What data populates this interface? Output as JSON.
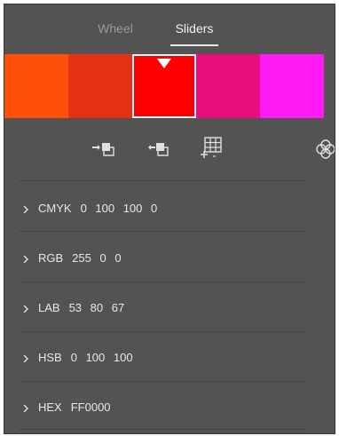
{
  "tabs": [
    {
      "label": "Wheel",
      "active": false
    },
    {
      "label": "Sliders",
      "active": true
    }
  ],
  "swatches": [
    {
      "color": "#FF4F0B"
    },
    {
      "color": "#E53212"
    },
    {
      "color": "#FF0000",
      "active": true
    },
    {
      "color": "#EA0E7D"
    },
    {
      "color": "#FF19F4"
    }
  ],
  "toolbar": {
    "icons": [
      "move-to-fill-icon",
      "move-to-stroke-icon",
      "add-to-swatches-grid-icon",
      "color-harmony-icon"
    ]
  },
  "modes": [
    {
      "label": "CMYK",
      "values": "0 100 100 0"
    },
    {
      "label": "RGB",
      "values": "255 0 0"
    },
    {
      "label": "LAB",
      "values": "53 80 67"
    },
    {
      "label": "HSB",
      "values": "0 100 100"
    },
    {
      "label": "HEX",
      "values": "FF0000"
    }
  ],
  "colors": {
    "panel_bg": "#535353",
    "text": "#e8e8e8",
    "tab_inactive": "#9a9a9a"
  }
}
